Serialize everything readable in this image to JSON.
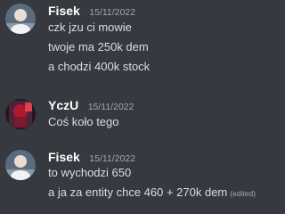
{
  "messages": [
    {
      "author": "Fisek",
      "timestamp": "15/11/2022",
      "lines": [
        "czk jzu ci mowie",
        "twoje ma 250k dem",
        "a chodzi 400k stock"
      ]
    },
    {
      "author": "YczU",
      "timestamp": "15/11/2022",
      "lines": [
        "Coś koło tego"
      ]
    },
    {
      "author": "Fisek",
      "timestamp": "15/11/2022",
      "lines": [
        "to wychodzi 650",
        "a ja za entity chce 460 + 270k dem"
      ],
      "edited_label": "(edited)"
    }
  ],
  "avatars": {
    "Fisek": {
      "icon": "user-avatar-icon",
      "bg": "#5a6b7e"
    },
    "YczU": {
      "icon": "user-avatar-icon",
      "bg": "#3a1c2a",
      "accent": "#d0203a"
    }
  },
  "colors": {
    "background": "#36393f",
    "text": "#dcddde",
    "username": "#ffffff",
    "muted": "#a3a6aa"
  }
}
